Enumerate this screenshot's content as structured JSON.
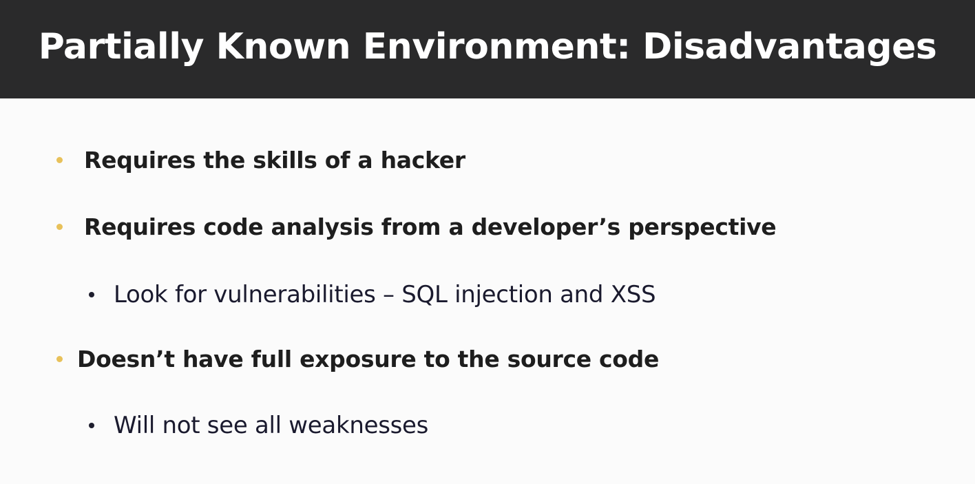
{
  "slide": {
    "title": "Partially Known Environment: Disadvantages",
    "bullets": [
      {
        "text": "Requires the skills of a hacker",
        "level": 1
      },
      {
        "text": "Requires code analysis from a developer’s perspective",
        "level": 1
      },
      {
        "text": "Look for vulnerabilities – SQL injection and XSS",
        "level": 2
      },
      {
        "text": "Doesn’t have full exposure to the source code",
        "level": 1
      },
      {
        "text": "Will not see all weaknesses",
        "level": 2
      }
    ]
  },
  "colors": {
    "title_bar": "#2a2a2b",
    "title_text": "#ffffff",
    "background": "#fbfbfb",
    "primary_bullet": "#e8c15a",
    "body_text": "#1e1e1e"
  }
}
